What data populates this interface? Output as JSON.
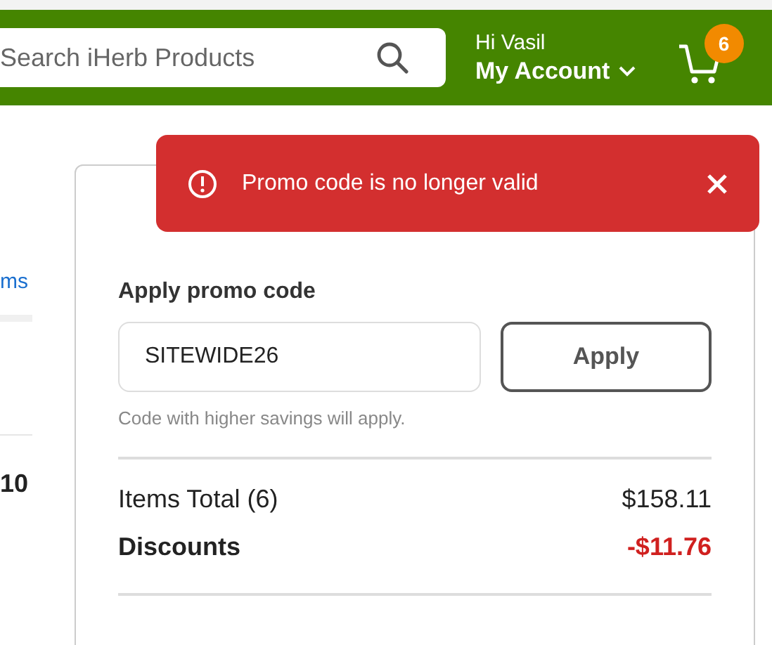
{
  "header": {
    "search": {
      "placeholder": "Search iHerb Products"
    },
    "greeting": "Hi  Vasil",
    "account": "My Account",
    "cart_count": "6"
  },
  "left_column": {
    "link": "ms",
    "value": "10"
  },
  "toast": {
    "message": "Promo code is no longer valid"
  },
  "order_summary": {
    "promo_label": "Apply promo code",
    "promo_value": "SITEWIDE26",
    "apply_button": "Apply",
    "hint": "Code with higher savings will apply.",
    "rows": [
      {
        "kind": "normal",
        "label": "Items Total (6)",
        "value": "$158.11"
      },
      {
        "kind": "discount",
        "label": "Discounts",
        "value": "-$11.76"
      }
    ]
  }
}
